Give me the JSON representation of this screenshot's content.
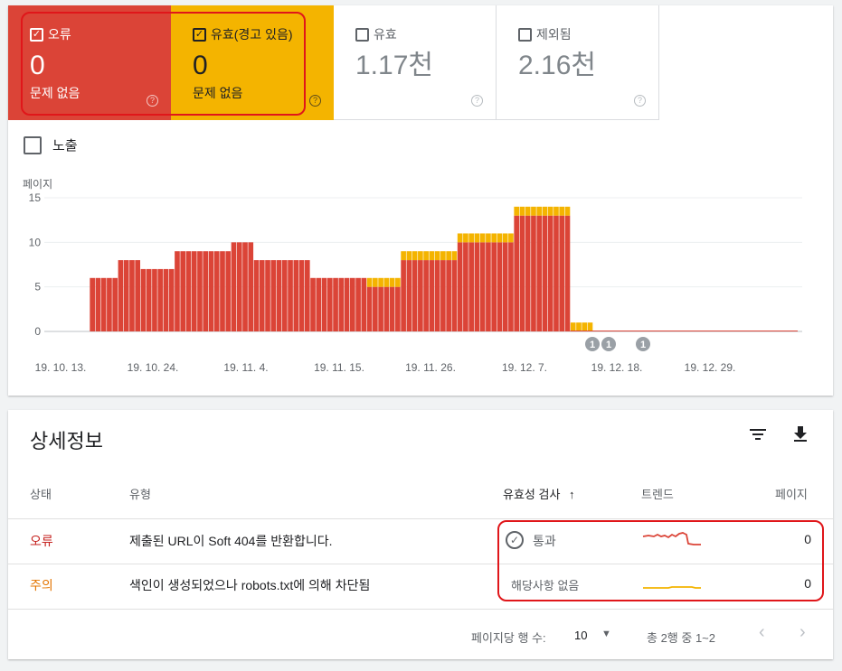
{
  "tiles": {
    "error": {
      "label": "오류",
      "value": "0",
      "sub": "문제 없음"
    },
    "warning": {
      "label": "유효(경고 있음)",
      "value": "0",
      "sub": "문제 없음"
    },
    "valid": {
      "label": "유효",
      "value": "1.17천"
    },
    "excluded": {
      "label": "제외됨",
      "value": "2.16천"
    }
  },
  "impressions_label": "노출",
  "chart_data": {
    "type": "bar",
    "ylabel": "페이지",
    "ylim": [
      0,
      15
    ],
    "yticks": [
      "0",
      "5",
      "10",
      "15"
    ],
    "xticks": [
      "19. 10. 13.",
      "19. 10. 24.",
      "19. 11. 4.",
      "19. 11. 15.",
      "19. 11. 26.",
      "19. 12. 7.",
      "19. 12. 18.",
      "19. 12. 29."
    ],
    "series": [
      {
        "color": "#db4437",
        "values": [
          0,
          0,
          0,
          0,
          0,
          0,
          0,
          0,
          6,
          6,
          6,
          6,
          6,
          8,
          8,
          8,
          8,
          7,
          7,
          7,
          7,
          7,
          7,
          9,
          9,
          9,
          9,
          9,
          9,
          9,
          9,
          9,
          9,
          10,
          10,
          10,
          10,
          8,
          8,
          8,
          8,
          8,
          8,
          8,
          8,
          8,
          8,
          6,
          6,
          6,
          6,
          6,
          6,
          6,
          6,
          6,
          6,
          5,
          5,
          5,
          5,
          5,
          5,
          8,
          8,
          8,
          8,
          8,
          8,
          8,
          8,
          8,
          8,
          10,
          10,
          10,
          10,
          10,
          10,
          10,
          10,
          10,
          10,
          13,
          13,
          13,
          13,
          13,
          13,
          13,
          13,
          13,
          13,
          0,
          0,
          0,
          0,
          0,
          0,
          0,
          0,
          0,
          0,
          0,
          0,
          0,
          0,
          0,
          0,
          0,
          0,
          0,
          0,
          0,
          0,
          0,
          0,
          0,
          0,
          0,
          0,
          0,
          0,
          0,
          0,
          0,
          0,
          0,
          0,
          0,
          0,
          0,
          0,
          0
        ]
      },
      {
        "color": "#f4b400",
        "values": [
          0,
          0,
          0,
          0,
          0,
          0,
          0,
          0,
          0,
          0,
          0,
          0,
          0,
          0,
          0,
          0,
          0,
          0,
          0,
          0,
          0,
          0,
          0,
          0,
          0,
          0,
          0,
          0,
          0,
          0,
          0,
          0,
          0,
          0,
          0,
          0,
          0,
          0,
          0,
          0,
          0,
          0,
          0,
          0,
          0,
          0,
          0,
          0,
          0,
          0,
          0,
          0,
          0,
          0,
          0,
          0,
          0,
          1,
          1,
          1,
          1,
          1,
          1,
          1,
          1,
          1,
          1,
          1,
          1,
          1,
          1,
          1,
          1,
          1,
          1,
          1,
          1,
          1,
          1,
          1,
          1,
          1,
          1,
          1,
          1,
          1,
          1,
          1,
          1,
          1,
          1,
          1,
          1,
          1,
          1,
          1,
          1,
          0,
          0,
          0,
          0,
          0,
          0,
          0,
          0,
          0,
          0,
          0,
          0,
          0,
          0,
          0,
          0,
          0,
          0,
          0,
          0,
          0,
          0,
          0,
          0,
          0,
          0,
          0,
          0,
          0,
          0,
          0,
          0,
          0,
          0,
          0,
          0,
          0,
          0,
          0,
          0,
          0
        ]
      }
    ],
    "annotations": [
      "1",
      "1",
      "1"
    ]
  },
  "details": {
    "title": "상세정보",
    "columns": {
      "status": "상태",
      "type": "유형",
      "validation": "유효성 검사",
      "trend": "트렌드",
      "pages": "페이지"
    },
    "rows": [
      {
        "status": "오류",
        "type": "제출된 URL이 Soft 404를 반환합니다.",
        "validation": "통과",
        "pages": "0"
      },
      {
        "status": "주의",
        "type": "색인이 생성되었으나 robots.txt에 의해 차단됨",
        "validation": "해당사항 없음",
        "pages": "0"
      }
    ],
    "pager": {
      "rows_label": "페이지당 행 수:",
      "rows_value": "10",
      "range": "총 2행 중 1~2"
    }
  },
  "colors": {
    "error": "#db4437",
    "warning": "#f4b400",
    "highlight": "#e0161a"
  }
}
